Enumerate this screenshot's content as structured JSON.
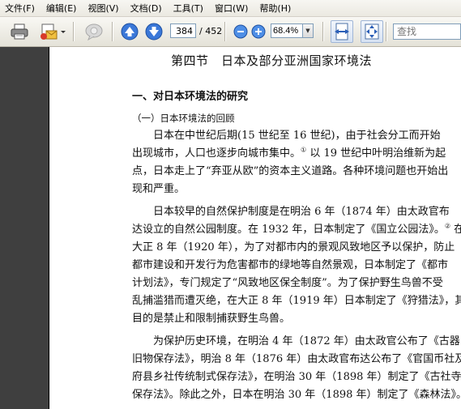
{
  "menu": {
    "items": [
      "文件(F)",
      "编辑(E)",
      "视图(V)",
      "文档(D)",
      "工具(T)",
      "窗口(W)",
      "帮助(H)"
    ]
  },
  "toolbar": {
    "current_page": "384",
    "total_pages": "/ 452",
    "zoom": "68.4%",
    "search_placeholder": "查找",
    "icons": [
      "print-icon",
      "email-icon",
      "comment-icon",
      "page-up-icon",
      "page-down-icon",
      "zoom-out-icon",
      "zoom-in-icon",
      "fit-width-icon",
      "fit-page-icon"
    ]
  },
  "document": {
    "section_title": "第四节　日本及部分亚洲国家环境法",
    "heading1": "一、对日本环境法的研究",
    "heading2": "（一）日本环境法的回顾",
    "paragraphs": [
      {
        "lines": [
          "日本在中世纪后期(15 世纪至 16 世纪)，由于社会分工而开始",
          "出现城市，人口也逐步向城市集中。",
          "点，日本走上了“弃亚从欧”的资本主义道路。各种环境问题也开始出",
          "现和严重。"
        ],
        "footnote_1": "①",
        "line2_tail": " 以 19 世纪中叶明治维新为起"
      },
      {
        "lines": [
          "日本较早的自然保护制度是在明治 6 年（1874 年）由太政官布",
          "达设立的自然公园制度。在 1932 年，日本制定了《国立公园法》。",
          "大正 8 年（1920 年），为了对都市内的景观风致地区予以保护，防止",
          "都市建设和开发行为危害都市的绿地等自然景观，日本制定了《都市",
          "计划法》，专门规定了“风致地区保全制度”。为了保护野生鸟兽不受",
          "乱捕滥猎而遭灭绝，在大正 8 年（1919 年）日本制定了《狩猎法》，其",
          "目的是禁止和限制捕获野生鸟兽。"
        ],
        "footnote_2": "②",
        "line2_tail": " 在"
      },
      {
        "lines": [
          "为保护历史环境，在明治 4 年（1872 年）由太政官公布了《古器",
          "旧物保存法》，明治 8 年（1876 年）由太政官布达公布了《官国币社及",
          "府县乡社传统制式保存法》，在明治 30 年（1898 年）制定了《古社寺",
          "保存法》。除此之外，日本在明治 30 年（1898 年）制定了《森林法》。"
        ]
      }
    ]
  }
}
